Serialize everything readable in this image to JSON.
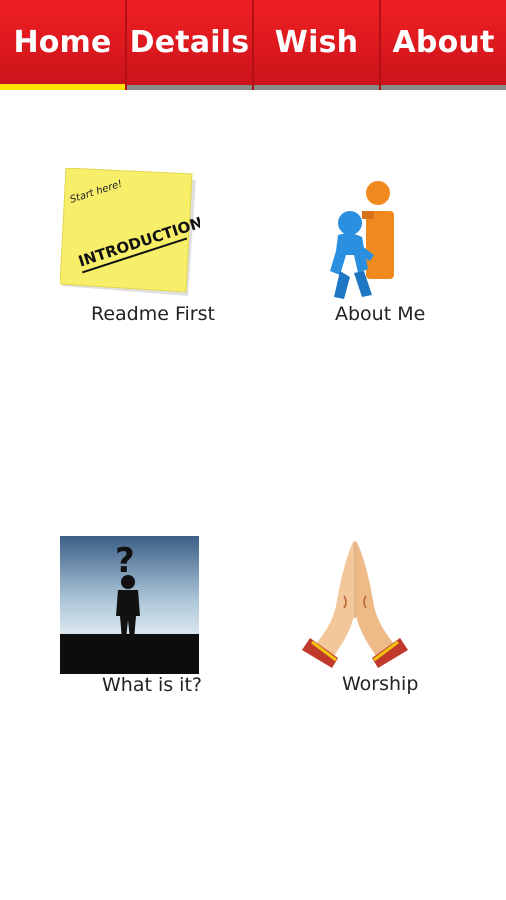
{
  "tabs": [
    {
      "label": "Home",
      "active": true
    },
    {
      "label": "Details",
      "active": false
    },
    {
      "label": "Wish",
      "active": false
    },
    {
      "label": "About",
      "active": false
    }
  ],
  "tiles": [
    {
      "label": "Readme First",
      "icon": "introduction-note-icon",
      "note_text": "INTRODUCTION",
      "note_small": "Start here!"
    },
    {
      "label": "About Me",
      "icon": "info-person-icon"
    },
    {
      "label": "What is it?",
      "icon": "question-silhouette-icon"
    },
    {
      "label": "Worship",
      "icon": "praying-hands-icon"
    }
  ],
  "colors": {
    "tabbar": "#d9181e",
    "active_indicator": "#ffe400",
    "inactive_indicator": "#8a8a8a"
  }
}
